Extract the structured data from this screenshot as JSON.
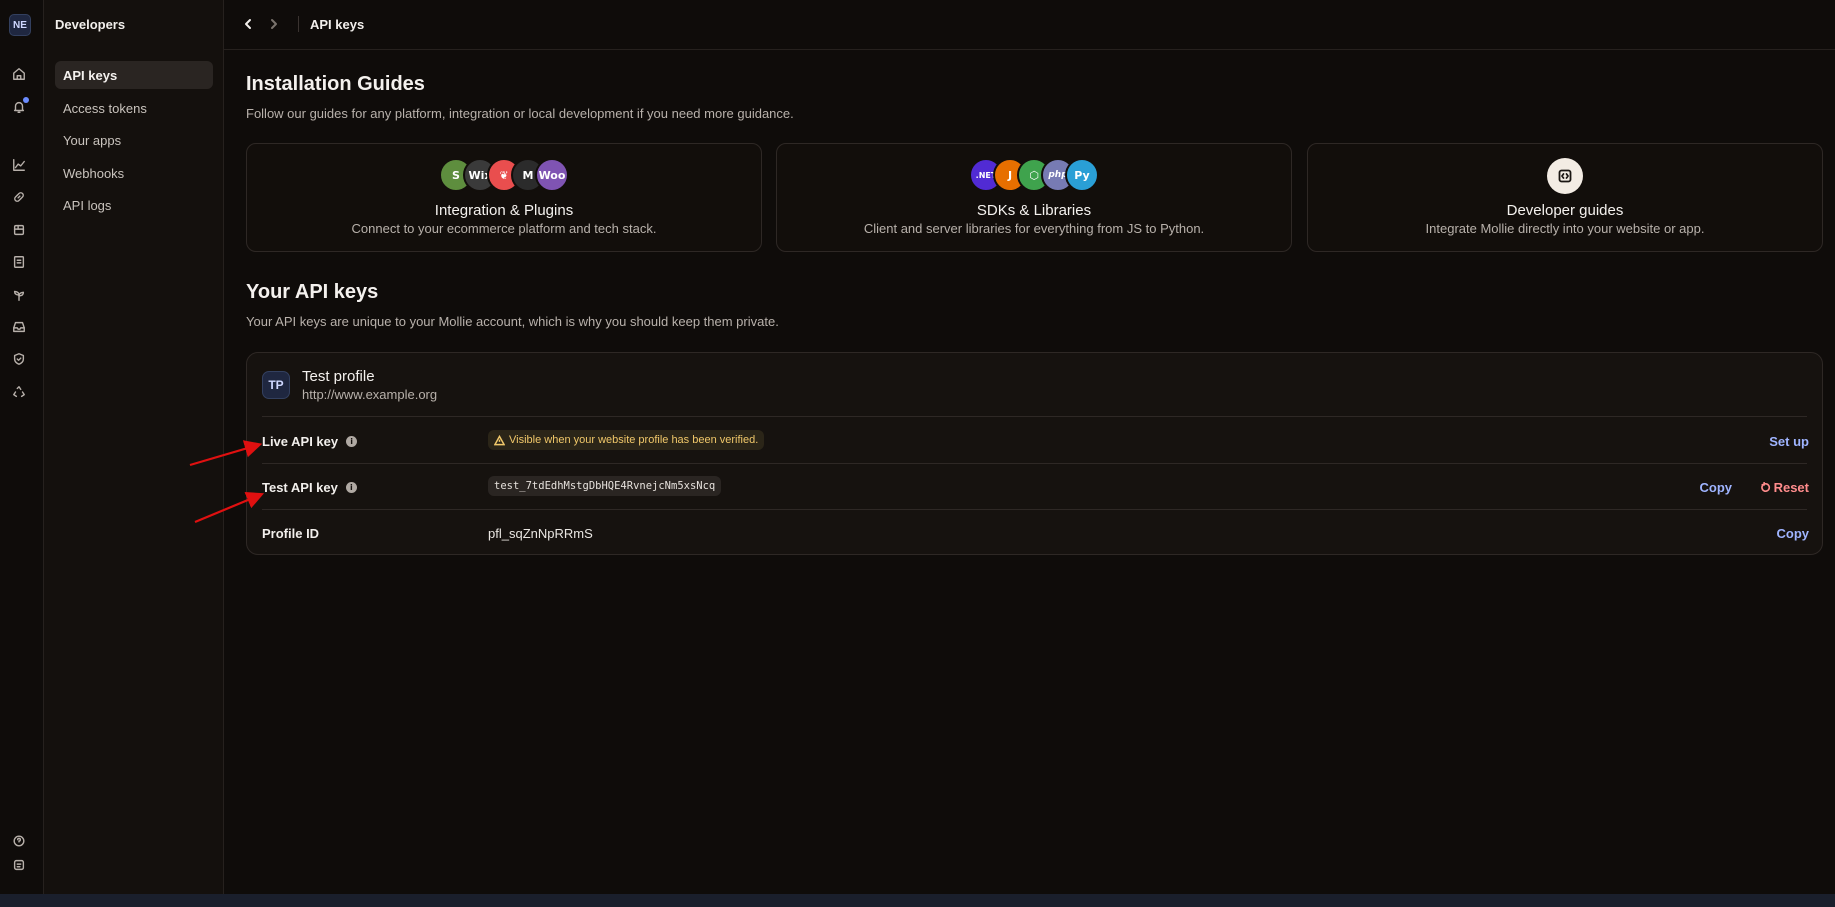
{
  "rail": {
    "org_initials": "NE",
    "icons": [
      "home-icon",
      "bell-icon",
      "chart-icon",
      "link-icon",
      "store-icon",
      "document-icon",
      "plant-icon",
      "inbox-icon",
      "shield-icon",
      "recycle-icon",
      "help-icon",
      "terminal-icon"
    ]
  },
  "sidebar": {
    "title": "Developers",
    "items": [
      {
        "label": "API keys",
        "active": true
      },
      {
        "label": "Access tokens"
      },
      {
        "label": "Your apps"
      },
      {
        "label": "Webhooks"
      },
      {
        "label": "API logs"
      }
    ]
  },
  "topbar": {
    "title": "API keys"
  },
  "guides": {
    "heading": "Installation Guides",
    "subheading": "Follow our guides for any platform, integration or local development if you need more guidance.",
    "cards": [
      {
        "title": "Integration & Plugins",
        "desc": "Connect to your ecommerce platform and tech stack.",
        "logos": [
          {
            "text": "S",
            "color": "#5e8e3e"
          },
          {
            "text": "Wix",
            "color": "#3a3a3a"
          },
          {
            "text": "❦",
            "color": "#e94e4e"
          },
          {
            "text": "M",
            "color": "#2b2b2b"
          },
          {
            "text": "Woo",
            "color": "#7f54b3"
          }
        ]
      },
      {
        "title": "SDKs & Libraries",
        "desc": "Client and server libraries for everything from JS to Python.",
        "logos": [
          {
            "text": ".NET",
            "color": "#512bd4"
          },
          {
            "text": "J",
            "color": "#e76f00"
          },
          {
            "text": "⬡",
            "color": "#3fa34d"
          },
          {
            "text": "php",
            "color": "#777bb3"
          },
          {
            "text": "Py",
            "color": "#2a9fd6"
          }
        ]
      },
      {
        "title": "Developer guides",
        "desc": "Integrate Mollie directly into your website or app."
      }
    ]
  },
  "api_keys": {
    "heading": "Your API keys",
    "subheading": "Your API keys are unique to your Mollie account, which is why you should keep them private.",
    "profile": {
      "initials": "TP",
      "name": "Test profile",
      "url": "http://www.example.org"
    },
    "rows": [
      {
        "label": "Live API key",
        "warning": "Visible when your website profile has been verified.",
        "action": "Set up"
      },
      {
        "label": "Test API key",
        "value": "test_7tdEdhMstgDbHQE4RvnejcNm5xsNcq",
        "action": "Copy",
        "action2": "Reset"
      },
      {
        "label": "Profile ID",
        "value": "pfl_sqZnNpRRmS",
        "action": "Copy"
      }
    ]
  },
  "colors": {
    "accent": "#9fb4ff",
    "danger": "#ff8c8c",
    "warning": "#f0c76a",
    "annotation": "#e01010"
  }
}
